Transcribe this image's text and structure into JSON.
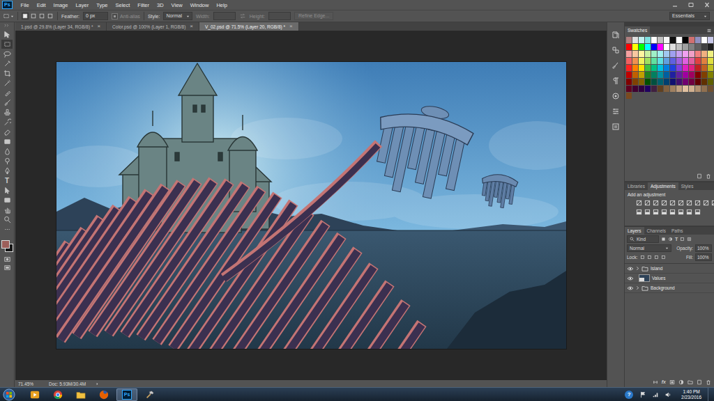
{
  "app": {
    "logo": "Ps"
  },
  "menu": [
    "File",
    "Edit",
    "Image",
    "Layer",
    "Type",
    "Select",
    "Filter",
    "3D",
    "View",
    "Window",
    "Help"
  ],
  "options": {
    "selection_modes": [
      {
        "selected": true
      },
      {
        "selected": false
      },
      {
        "selected": false
      },
      {
        "selected": false
      }
    ],
    "feather_label": "Feather:",
    "feather_value": "0 px",
    "anti_alias": {
      "label": "Anti-alias",
      "disabled": true,
      "checked": true
    },
    "style_label": "Style:",
    "style_value": "Normal",
    "width": {
      "label": "Width:",
      "disabled": true
    },
    "height": {
      "label": "Height:",
      "disabled": true
    },
    "refine_edge": {
      "label": "Refine Edge...",
      "disabled": true
    },
    "workspace": "Essentials"
  },
  "tabs": [
    {
      "label": "1.psd @ 29.8% (Layer 34, RGB/8) *",
      "close": "×",
      "selected": false
    },
    {
      "label": "Color.psd @ 100% (Layer 1, RGB/8)",
      "close": "×",
      "selected": false
    },
    {
      "label": "V_02.psd @ 71.5% (Layer 20, RGB/8) *",
      "close": "×",
      "selected": true
    }
  ],
  "tools": [
    {
      "kind": "move",
      "label": "",
      "selected": false
    },
    {
      "kind": "marquee",
      "label": "",
      "selected": true
    },
    {
      "kind": "lasso",
      "label": "",
      "selected": false
    },
    {
      "kind": "quick",
      "label": "",
      "selected": false
    },
    {
      "kind": "crop",
      "label": "",
      "selected": false
    },
    {
      "kind": "eyedropper",
      "label": "",
      "selected": false
    },
    {
      "kind": "healing",
      "label": "",
      "selected": false
    },
    {
      "kind": "brush",
      "label": "",
      "selected": false
    },
    {
      "kind": "stamp",
      "label": "",
      "selected": false
    },
    {
      "kind": "history",
      "label": "",
      "selected": false
    },
    {
      "kind": "eraser",
      "label": "",
      "selected": false
    },
    {
      "kind": "gradient",
      "label": "",
      "selected": false
    },
    {
      "kind": "blur",
      "label": "",
      "selected": false
    },
    {
      "kind": "dodge",
      "label": "",
      "selected": false
    },
    {
      "kind": "pen",
      "label": "",
      "selected": false
    },
    {
      "kind": "type",
      "label": "T",
      "selected": false
    },
    {
      "kind": "pathselect",
      "label": "",
      "selected": false
    },
    {
      "kind": "shape",
      "label": "",
      "selected": false
    },
    {
      "kind": "hand",
      "label": "",
      "selected": false
    },
    {
      "kind": "zoom",
      "label": "",
      "selected": false
    },
    {
      "kind": "more",
      "label": "",
      "selected": false
    }
  ],
  "colors": {
    "foreground": "#9c5f5a",
    "background": "#151515"
  },
  "status": {
    "zoom": "71.45%",
    "doc": "Doc: 5.93M/30.4M"
  },
  "swatches": {
    "title": "Swatches",
    "colors": [
      "#b08080",
      "#e0e0e0",
      "#c0f0f0",
      "#80e0e0",
      "#ffffff",
      "#c0c0c0",
      "#f8f8f8",
      "#101010",
      "#ffffff",
      "#000000",
      "#d07070",
      "#9090c0",
      "#ffffff",
      "#c8c8e8",
      "#ff0000",
      "#ffff00",
      "#00ff00",
      "#00ffff",
      "#0000ff",
      "#ff00ff",
      "#ffffff",
      "#e0e0e0",
      "#c0c0c0",
      "#a0a0a0",
      "#808080",
      "#606060",
      "#404040",
      "#202020",
      "#f4a0a0",
      "#f8c8a0",
      "#fff4a0",
      "#c8f0a0",
      "#a0f0c8",
      "#a0f0f0",
      "#a0c8f0",
      "#a0a0f0",
      "#c8a0f0",
      "#f0a0f0",
      "#f0a0c8",
      "#f08080",
      "#f0b080",
      "#f0f080",
      "#f06060",
      "#f09050",
      "#f0f060",
      "#a0e060",
      "#60e0a0",
      "#60e0e0",
      "#60a0e0",
      "#6060e0",
      "#a060e0",
      "#e060e0",
      "#e060a0",
      "#e04040",
      "#e08040",
      "#e0e040",
      "#ff2020",
      "#ff8000",
      "#ffe000",
      "#40c040",
      "#00c080",
      "#00c0e0",
      "#0080e0",
      "#2040e0",
      "#8040e0",
      "#e020c0",
      "#e02080",
      "#c02020",
      "#c06020",
      "#c0c020",
      "#c00000",
      "#c06000",
      "#c0a000",
      "#208020",
      "#008060",
      "#0090a0",
      "#0060a0",
      "#2020a0",
      "#6020a0",
      "#a000a0",
      "#a00060",
      "#800000",
      "#804000",
      "#808000",
      "#800000",
      "#804000",
      "#806000",
      "#005000",
      "#005040",
      "#006070",
      "#004070",
      "#101070",
      "#401070",
      "#700070",
      "#700040",
      "#600000",
      "#603000",
      "#606000",
      "#600020",
      "#400030",
      "#300040",
      "#200060",
      "#402040",
      "#604020",
      "#806040",
      "#a08060",
      "#c0a080",
      "#e0c0a0",
      "#d0b090",
      "#b09070",
      "#907050",
      "#705030",
      "#7a4a20"
    ]
  },
  "adjustments": {
    "tabs": [
      {
        "label": "Libraries",
        "selected": false
      },
      {
        "label": "Adjustments",
        "selected": true
      },
      {
        "label": "Styles",
        "selected": false
      }
    ],
    "hint": "Add an adjustment"
  },
  "layers": {
    "tabs": [
      {
        "label": "Layers",
        "selected": true
      },
      {
        "label": "Channels",
        "selected": false
      },
      {
        "label": "Paths",
        "selected": false
      }
    ],
    "filter": "Kind",
    "type_filter": "T",
    "blend_mode": "Normal",
    "opacity_label": "Opacity:",
    "opacity": "100%",
    "lock_label": "Lock:",
    "fill_label": "Fill:",
    "fill": "100%",
    "items": [
      {
        "name": "Island",
        "kind": "group",
        "visible": true,
        "selected": false
      },
      {
        "name": "Values",
        "kind": "layer",
        "visible": true,
        "selected": false
      },
      {
        "name": "Background",
        "kind": "group",
        "visible": true,
        "selected": false
      }
    ],
    "footer_fx": "fx"
  },
  "taskbar": {
    "apps": [
      {
        "kind": "media",
        "label": "",
        "selected": false
      },
      {
        "kind": "chrome",
        "label": "",
        "selected": false
      },
      {
        "kind": "explorer",
        "label": "",
        "selected": false
      },
      {
        "kind": "firefox",
        "label": "",
        "selected": false
      },
      {
        "kind": "photoshop",
        "label": "Ps",
        "selected": true
      },
      {
        "kind": "tool",
        "label": "",
        "selected": false
      }
    ],
    "help": "?",
    "time": "1:40 PM",
    "date": "2/23/2016"
  }
}
